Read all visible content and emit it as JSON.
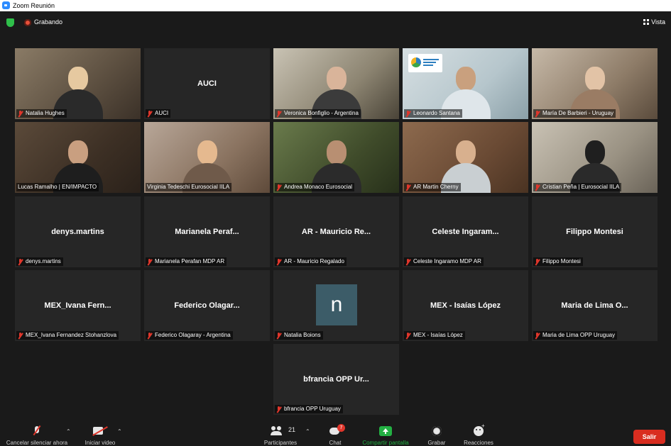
{
  "window": {
    "title": "Zoom Reunión"
  },
  "topbar": {
    "recording_label": "Grabando",
    "view_label": "Vista"
  },
  "tiles": [
    {
      "name": "Natalia Hughes",
      "display": "",
      "has_video": true
    },
    {
      "name": "AUCI",
      "display": "AUCI",
      "has_video": false
    },
    {
      "name": "Veronica Bonfiglio - Argentina",
      "display": "",
      "has_video": true
    },
    {
      "name": "Leonardo Santana",
      "display": "",
      "has_video": true
    },
    {
      "name": "María De Barbieri - Uruguay",
      "display": "",
      "has_video": true
    },
    {
      "name": "Lucas Ramalho | EN/IMPACTO",
      "display": "",
      "has_video": true,
      "active_speaker": true
    },
    {
      "name": "Virginia Tedeschi Eurosocial IILA",
      "display": "",
      "has_video": true
    },
    {
      "name": "Andrea Monaco Eurosocial",
      "display": "",
      "has_video": true
    },
    {
      "name": "AR Martin Cherny",
      "display": "",
      "has_video": true
    },
    {
      "name": "Cristian Peña | Eurosocial IILA",
      "display": "",
      "has_video": true
    },
    {
      "name": "denys.martins",
      "display": "denys.martins",
      "has_video": false
    },
    {
      "name": "Marianela Perafan MDP AR",
      "display": "Marianela Peraf...",
      "has_video": false
    },
    {
      "name": "AR - Mauricio Regalado",
      "display": "AR - Mauricio Re...",
      "has_video": false
    },
    {
      "name": "Celeste Ingaramo MDP AR",
      "display": "Celeste Ingaram...",
      "has_video": false
    },
    {
      "name": "Filippo Montesi",
      "display": "Filippo Montesi",
      "has_video": false
    },
    {
      "name": "MEX_Ivana Fernandez Stohanzlova",
      "display": "MEX_Ivana Fern...",
      "has_video": false
    },
    {
      "name": "Federico Olagaray - Argentina",
      "display": "Federico Olagar...",
      "has_video": false
    },
    {
      "name": "Natalia Boions",
      "display": "",
      "avatar_letter": "n",
      "has_video": false
    },
    {
      "name": "MEX - Isaías López",
      "display": "MEX - Isaías López",
      "has_video": false
    },
    {
      "name": "Maria de Lima OPP Uruguay",
      "display": "Maria de Lima O...",
      "has_video": false
    },
    {
      "name": "bfrancia OPP Uruguay",
      "display": "bfrancia OPP Ur...",
      "has_video": false
    }
  ],
  "toolbar": {
    "unmute_label": "Cancelar silenciar ahora",
    "video_label": "Iniciar video",
    "participants_label": "Participantes",
    "participants_count": "21",
    "chat_label": "Chat",
    "chat_badge": "7",
    "share_label": "Compartir pantalla",
    "record_label": "Grabar",
    "reactions_label": "Reacciones",
    "leave_label": "Salir"
  },
  "colors": {
    "accent_share": "#23b043",
    "leave": "#d92d20",
    "active_speaker": "#c9d33b"
  }
}
